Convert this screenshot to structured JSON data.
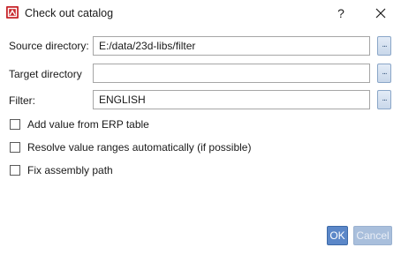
{
  "dialog": {
    "title": "Check out catalog",
    "help_label": "?",
    "icons": {
      "app": "app-logo-icon",
      "close": "close-icon"
    }
  },
  "form": {
    "source_label": "Source directory:",
    "source_value": "E:/data/23d-libs/filter",
    "target_label": "Target directory",
    "target_value": "",
    "filter_label": "Filter:",
    "filter_value": "ENGLISH",
    "browse_label": "..."
  },
  "options": {
    "erp_label": "Add value from ERP table",
    "erp_checked": false,
    "resolve_label": "Resolve value ranges automatically (if possible)",
    "resolve_checked": false,
    "assembly_label": "Fix assembly path",
    "assembly_checked": false
  },
  "buttons": {
    "ok_label": "OK",
    "cancel_label": "Cancel"
  },
  "colors": {
    "accent": "#5b87c8",
    "brand": "#c8282d"
  }
}
